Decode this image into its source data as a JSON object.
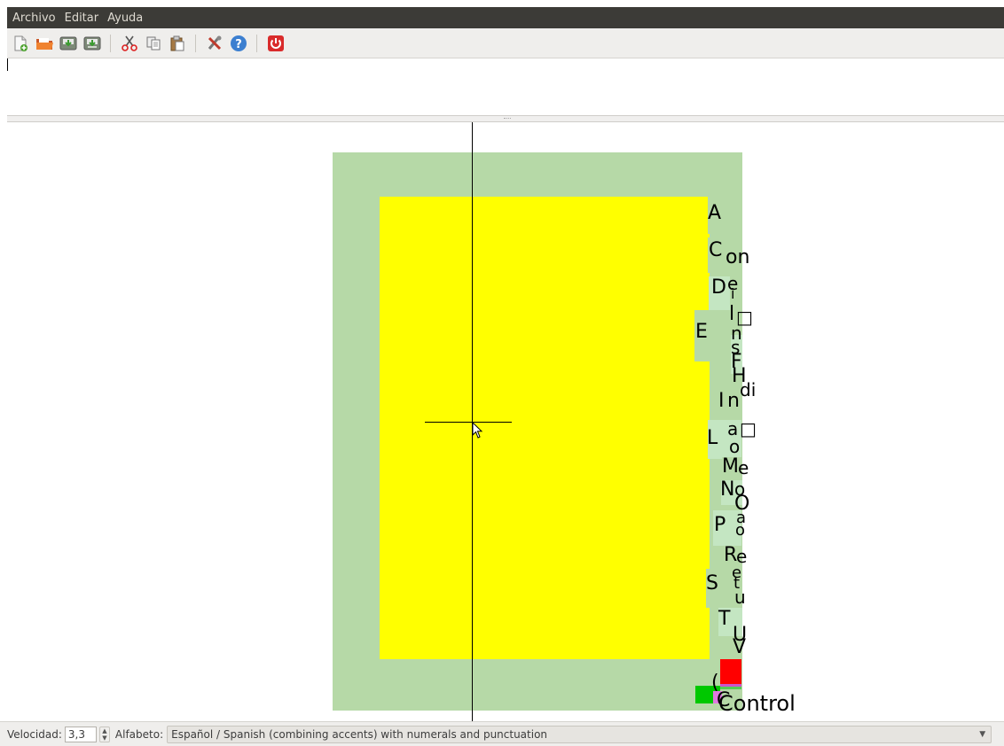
{
  "menu": {
    "items": [
      "Archivo",
      "Editar",
      "Ayuda"
    ]
  },
  "toolbar": {
    "icons": [
      "new-file-icon",
      "open-folder-icon",
      "save-icon",
      "save-as-icon",
      "cut-icon",
      "copy-icon",
      "paste-icon",
      "preferences-icon",
      "help-icon",
      "quit-icon"
    ]
  },
  "colors": {
    "menubar": "#3c3b37",
    "outer_box": "#b6d9a7",
    "inner_box": "#ffff00",
    "alt_box": "#c4e6c2",
    "red_box": "#ff0000",
    "green_box": "#00c800"
  },
  "dasher": {
    "letters": [
      {
        "t": "A",
        "label": "letter-a"
      },
      {
        "t": "C",
        "label": "letter-c"
      },
      {
        "t": "on",
        "label": "text-on"
      },
      {
        "t": "D",
        "label": "letter-d"
      },
      {
        "t": "e",
        "label": "letter-e-small"
      },
      {
        "t": "i",
        "label": "letter-i-small"
      },
      {
        "t": "l",
        "label": "letter-l-small"
      },
      {
        "t": "□",
        "label": "box-glyph"
      },
      {
        "t": "E",
        "label": "letter-e"
      },
      {
        "t": "n",
        "label": "letter-n-small"
      },
      {
        "t": "s",
        "label": "letter-s-small"
      },
      {
        "t": "F",
        "label": "letter-f"
      },
      {
        "t": "H",
        "label": "letter-h"
      },
      {
        "t": "di",
        "label": "text-di"
      },
      {
        "t": "I",
        "label": "letter-i"
      },
      {
        "t": "n",
        "label": "letter-n-small-2"
      },
      {
        "t": "a",
        "label": "letter-a-small"
      },
      {
        "t": "□",
        "label": "box-glyph-2"
      },
      {
        "t": "L",
        "label": "letter-l"
      },
      {
        "t": "o",
        "label": "letter-o-small"
      },
      {
        "t": "M",
        "label": "letter-m"
      },
      {
        "t": "e",
        "label": "letter-e-small-2"
      },
      {
        "t": "N",
        "label": "letter-n"
      },
      {
        "t": "o",
        "label": "letter-o-small-2"
      },
      {
        "t": "O",
        "label": "letter-o"
      },
      {
        "t": "a",
        "label": "letter-a-small-2"
      },
      {
        "t": "P",
        "label": "letter-p"
      },
      {
        "t": "o",
        "label": "letter-o-small-3"
      },
      {
        "t": "R",
        "label": "letter-r"
      },
      {
        "t": "e",
        "label": "letter-e-small-3"
      },
      {
        "t": "S",
        "label": "letter-s"
      },
      {
        "t": "e",
        "label": "letter-e-small-4"
      },
      {
        "t": "t",
        "label": "letter-t-small"
      },
      {
        "t": "u",
        "label": "letter-u-small"
      },
      {
        "t": "T",
        "label": "letter-t"
      },
      {
        "t": "U",
        "label": "letter-u"
      },
      {
        "t": "V",
        "label": "letter-v"
      },
      {
        "t": "(",
        "label": "paren-glyph"
      },
      {
        "t": "C",
        "label": "letter-c-2"
      },
      {
        "t": "Control",
        "label": "text-control"
      }
    ]
  },
  "status": {
    "speed_label": "Velocidad:",
    "speed_value": "3,3",
    "alphabet_label": "Alfabeto:",
    "alphabet_value": "Español / Spanish  (combining accents) with numerals and punctuation"
  }
}
